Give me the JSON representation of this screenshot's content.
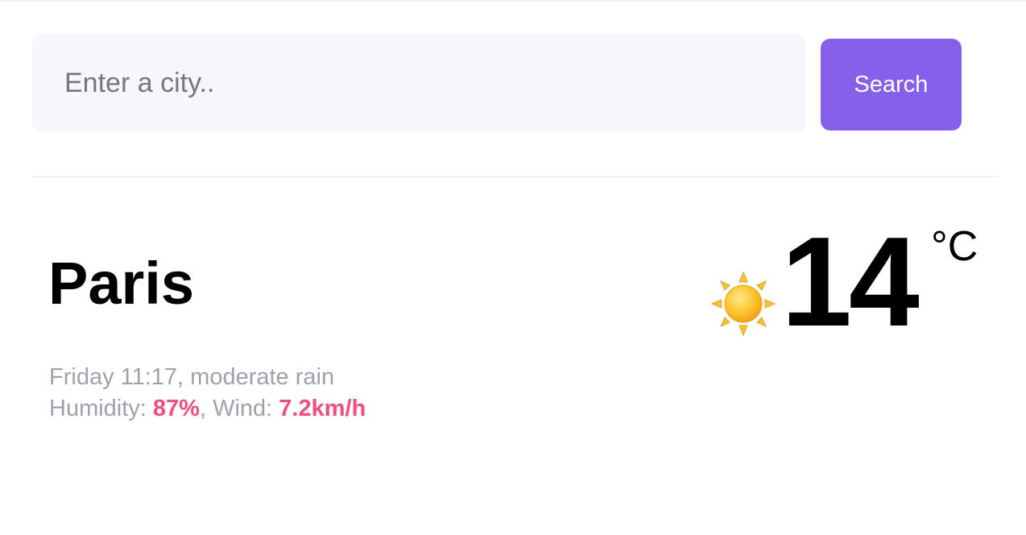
{
  "search": {
    "placeholder": "Enter a city..",
    "value": "",
    "button_label": "Search"
  },
  "weather": {
    "city": "Paris",
    "day_time": "Friday 11:17",
    "description": "moderate rain",
    "humidity_label": "Humidity:",
    "humidity_value": "87%",
    "wind_label": "Wind:",
    "wind_value": "7.2km/h",
    "temperature": "14",
    "unit": "°C",
    "icon": "sun-icon"
  },
  "colors": {
    "accent": "#8760ea",
    "highlight": "#f04d80",
    "muted_text": "#a29fad",
    "input_bg": "#f7f6fd"
  }
}
